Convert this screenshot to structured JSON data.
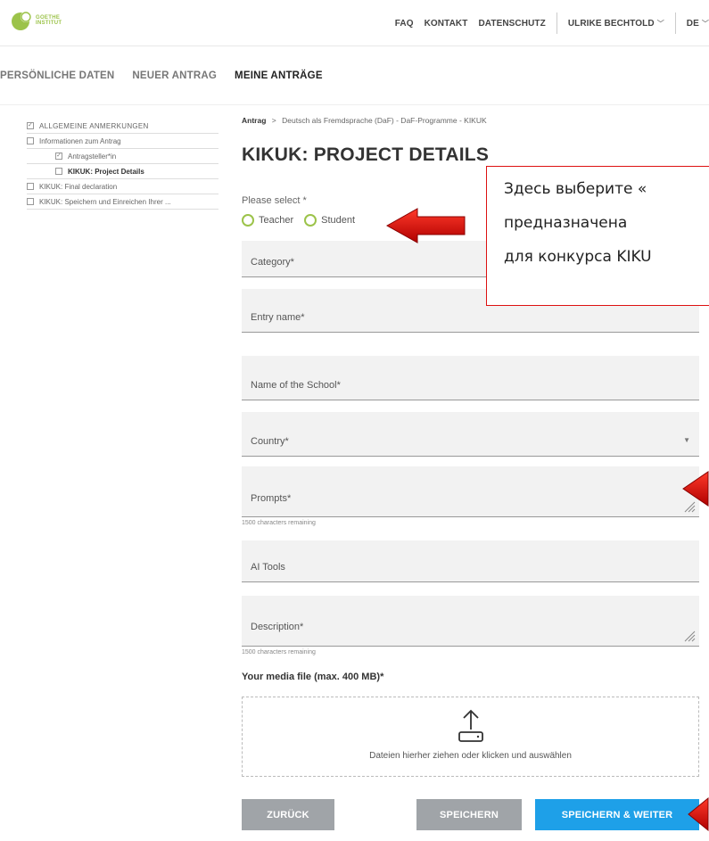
{
  "header": {
    "logo_text_line1": "GOETHE",
    "logo_text_line2": "INSTITUT",
    "nav": {
      "faq": "FAQ",
      "kontakt": "KONTAKT",
      "datenschutz": "DATENSCHUTZ",
      "user": "ULRIKE BECHTOLD",
      "language": "DE"
    }
  },
  "main_nav": {
    "tabs": [
      {
        "label": "PERSÖNLICHE DATEN"
      },
      {
        "label": "NEUER ANTRAG"
      },
      {
        "label": "MEINE ANTRÄGE"
      }
    ]
  },
  "sidebar": {
    "items": [
      {
        "label": "ALLGEMEINE ANMERKUNGEN",
        "checked": true
      },
      {
        "label": "Informationen zum Antrag",
        "checked": false
      },
      {
        "label": "Antragsteller*in",
        "checked": true
      },
      {
        "label": "KIKUK: Project Details",
        "checked": false
      },
      {
        "label": "KIKUK: Final declaration",
        "checked": false
      },
      {
        "label": "KIKUK: Speichern und Einreichen Ihrer ...",
        "checked": false
      }
    ]
  },
  "breadcrumb": {
    "root": "Antrag",
    "separator": ">",
    "path": "Deutsch als Fremdsprache (DaF) - DaF-Programme - KIKUK"
  },
  "page_title": "KIKUK: PROJECT DETAILS",
  "form": {
    "select_label": "Please select *",
    "radio_teacher": "Teacher",
    "radio_student": "Student",
    "category": "Category*",
    "entry_name": "Entry name*",
    "school_name": "Name of the School*",
    "country": "Country*",
    "prompts": "Prompts*",
    "prompts_hint": "1500 characters remaining",
    "ai_tools": "AI Tools",
    "description": "Description*",
    "description_hint": "1500 characters remaining",
    "media_label": "Your media file (max. 400 MB)*",
    "dropzone_text": "Dateien hierher ziehen oder klicken und auswählen"
  },
  "buttons": {
    "back": "ZURÜCK",
    "save": "SPEICHERN",
    "save_next": "SPEICHERN & WEITER"
  },
  "annotation": {
    "line1": "Здесь выберите «",
    "line2": "предназначена",
    "line3": "для конкурса KIKU"
  },
  "colors": {
    "accent_green": "#9cc34a",
    "primary_blue": "#1ea0e8",
    "button_grey": "#a0a4a8",
    "annotation_red": "#dd1111"
  }
}
